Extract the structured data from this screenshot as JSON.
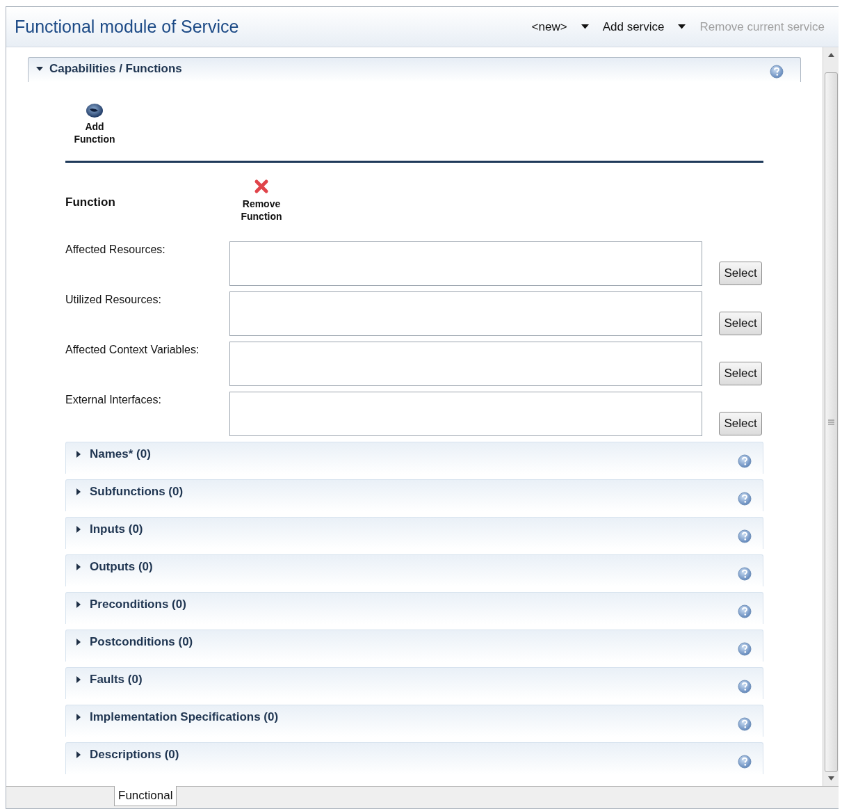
{
  "header": {
    "title": "Functional module of Service",
    "toolbar": [
      {
        "label": "<new>",
        "kind": "dropdown",
        "disabled": false
      },
      {
        "label": "Add service",
        "kind": "dropdown",
        "disabled": false
      },
      {
        "label": "Remove current service",
        "kind": "action",
        "disabled": true
      }
    ]
  },
  "capabilities": {
    "title": "Capabilities / Functions",
    "expanded": true,
    "add_button": "Add Function",
    "function": {
      "label": "Function",
      "remove_button": "Remove Function",
      "fields": [
        {
          "label": "Affected Resources:",
          "button": "Select"
        },
        {
          "label": "Utilized Resources:",
          "button": "Select"
        },
        {
          "label": "Affected Context Variables:",
          "button": "Select"
        },
        {
          "label": "External Interfaces:",
          "button": "Select"
        }
      ]
    },
    "sections": [
      {
        "title": "Names* (0)",
        "expanded": false
      },
      {
        "title": "Subfunctions (0)",
        "expanded": false
      },
      {
        "title": "Inputs (0)",
        "expanded": false
      },
      {
        "title": "Outputs (0)",
        "expanded": false
      },
      {
        "title": "Preconditions (0)",
        "expanded": false
      },
      {
        "title": "Postconditions (0)",
        "expanded": false
      },
      {
        "title": "Faults (0)",
        "expanded": false
      },
      {
        "title": "Implementation Specifications (0)",
        "expanded": false
      },
      {
        "title": "Descriptions (0)",
        "expanded": false
      }
    ]
  },
  "bottom_tabs": [
    {
      "label": "Functional",
      "selected": true
    }
  ]
}
